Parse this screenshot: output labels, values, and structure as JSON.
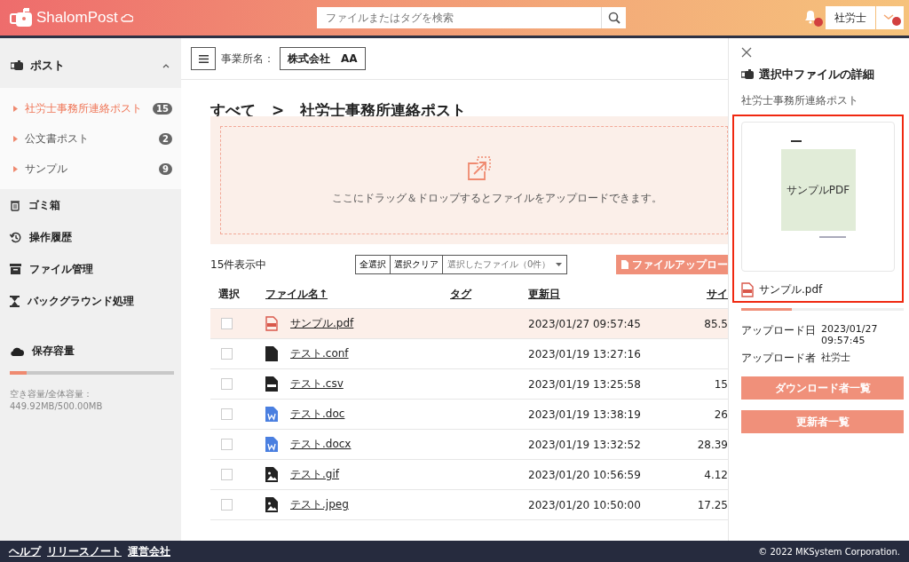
{
  "header": {
    "logo": "ShalomPost",
    "search": {
      "placeholder": "ファイルまたはタグを検索"
    },
    "notifications": true,
    "user": "社労士"
  },
  "toolbar": {
    "office_label": "事業所名：",
    "office": "株式会社　AA"
  },
  "sidebar": {
    "post": {
      "label": "ポスト",
      "expanded": true,
      "items": [
        {
          "label": "社労士事務所連絡ポスト",
          "count": "15",
          "selected": true
        },
        {
          "label": "公文書ポスト",
          "count": "2",
          "selected": false
        },
        {
          "label": "サンプル",
          "count": "9",
          "selected": false
        }
      ]
    },
    "nav": [
      {
        "kind": "trash",
        "label": "ゴミ箱"
      },
      {
        "kind": "history",
        "label": "操作履歴"
      },
      {
        "kind": "archive",
        "label": "ファイル管理"
      },
      {
        "kind": "hourglass",
        "label": "バックグラウンド処理"
      }
    ],
    "storage": {
      "label": "保存容量",
      "level": 0.1,
      "caption": "空き容量/全体容量：449.92MB/500.00MB"
    }
  },
  "breadcrumb": {
    "root": "すべて",
    "separator": ">",
    "current": "社労士事務所連絡ポスト"
  },
  "dropzone": {
    "text": "ここにドラッグ＆ドロップするとファイルをアップロードできます。"
  },
  "list": {
    "count": "15件表示中",
    "select_all": "全選択",
    "clear": "選択クリア",
    "selected_files": "選択したファイル（0件）",
    "upload": "ファイルアップロー"
  },
  "table": {
    "columns": [
      {
        "label": "選択",
        "link": false
      },
      {
        "label": "ファイル名",
        "link": true,
        "sort": "↑"
      },
      {
        "label": "タグ",
        "link": true
      },
      {
        "label": "更新日",
        "link": true
      },
      {
        "label": "サイ",
        "link": true
      }
    ],
    "rows": [
      {
        "kind": "pdf",
        "name": "サンプル.pdf",
        "date": "2023/01/27 09:57:45",
        "size": "85.5",
        "selected": true,
        "checked": false
      },
      {
        "kind": "file",
        "name": "テスト.conf",
        "date": "2023/01/19 13:27:16",
        "selected": false,
        "checked": false
      },
      {
        "kind": "csv",
        "name": "テスト.csv",
        "date": "2023/01/19 13:25:58",
        "size": "15",
        "selected": false,
        "checked": false
      },
      {
        "kind": "word",
        "name": "テスト.doc",
        "date": "2023/01/19 13:38:19",
        "size": "26",
        "selected": false,
        "checked": false
      },
      {
        "kind": "word",
        "name": "テスト.docx",
        "date": "2023/01/19 13:32:52",
        "size": "28.39",
        "selected": false,
        "checked": false
      },
      {
        "kind": "image",
        "name": "テスト.gif",
        "date": "2023/01/20 10:56:59",
        "size": "4.12",
        "selected": false,
        "checked": false
      },
      {
        "kind": "image",
        "name": "テスト.jpeg",
        "date": "2023/01/20 10:50:00",
        "size": "17.25",
        "selected": false,
        "checked": false
      }
    ]
  },
  "detail": {
    "title": "選択中ファイルの詳細",
    "folder": "社労士事務所連絡ポスト",
    "preview_text": "サンプルPDF",
    "file_name": "サンプル.pdf",
    "level": 0.31,
    "meta": [
      {
        "label": "アップロード日",
        "value": "2023/01/27 09:57:45"
      },
      {
        "label": "アップロード者",
        "value": "社労士"
      }
    ],
    "buttons": [
      "ダウンロード者一覧",
      "更新者一覧"
    ]
  },
  "footer": {
    "links": [
      "ヘルプ",
      "リリースノート",
      "運営会社"
    ],
    "copyright": "© 2022 MKSystem Corporation."
  }
}
